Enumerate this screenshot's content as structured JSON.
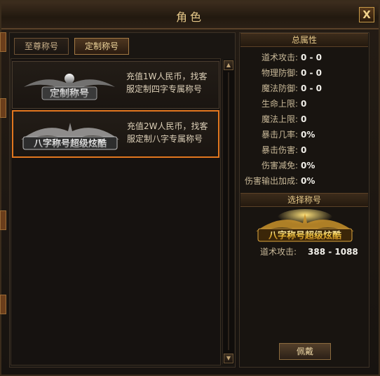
{
  "window": {
    "title": "角色",
    "close_label": "X"
  },
  "tabs": [
    {
      "label": "至尊称号",
      "active": false
    },
    {
      "label": "定制称号",
      "active": true
    }
  ],
  "titles": [
    {
      "badge_text": "定制称号",
      "desc_line1": "充值1W人民币，找客",
      "desc_line2": "服定制四字专属称号",
      "selected": false
    },
    {
      "badge_text": "八字称号超级炫酷",
      "desc_line1": "充值2W人民币，找客",
      "desc_line2": "服定制八字专属称号",
      "selected": true
    }
  ],
  "total_attributes": {
    "header": "总属性",
    "stats": [
      {
        "label": "道术攻击:",
        "value": "0 - 0"
      },
      {
        "label": "物理防御:",
        "value": "0 - 0"
      },
      {
        "label": "魔法防御:",
        "value": "0 - 0"
      },
      {
        "label": "生命上限:",
        "value": "0"
      },
      {
        "label": "魔法上限:",
        "value": "0"
      },
      {
        "label": "暴击几率:",
        "value": "0%"
      },
      {
        "label": "暴击伤害:",
        "value": "0"
      },
      {
        "label": "伤害减免:",
        "value": "0%"
      },
      {
        "label": "伤害输出加成:",
        "value": "0%"
      }
    ]
  },
  "selected_title": {
    "header": "选择称号",
    "badge_text": "八字称号超级炫酷",
    "stat_label": "道术攻击:",
    "stat_value": "388 - 1088"
  },
  "wear_button": {
    "label": "佩戴"
  },
  "scrollbar": {
    "up_icon": "triangle-up",
    "down_icon": "triangle-down"
  },
  "colors": {
    "accent_orange": "#e2771f",
    "title_gold": "#e7c98a",
    "text_light": "#f2f0ea"
  }
}
